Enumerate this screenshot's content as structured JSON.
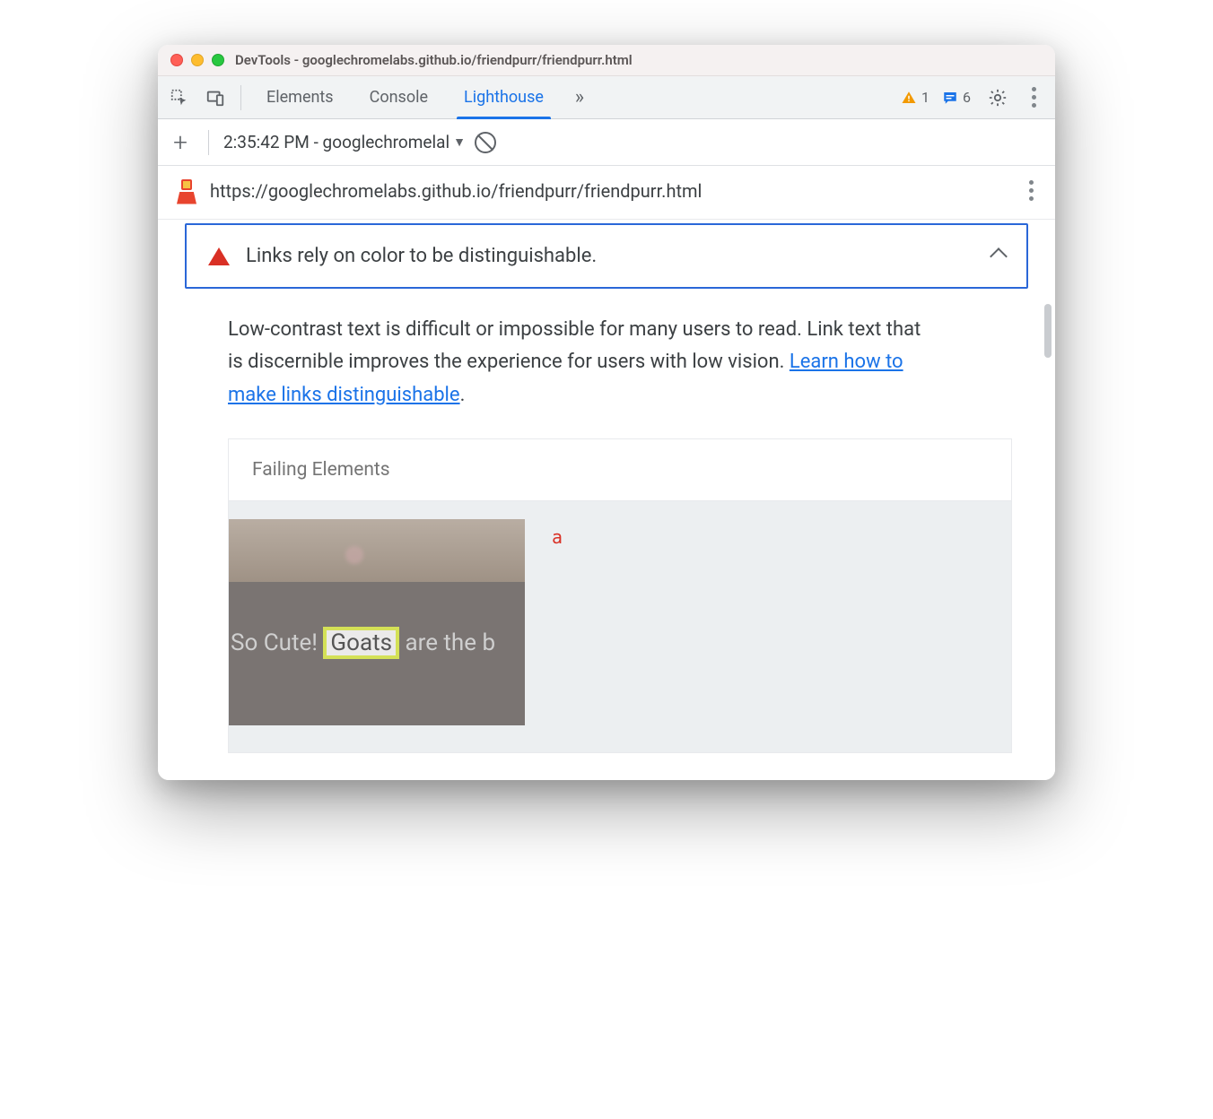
{
  "window": {
    "title": "DevTools - googlechromelabs.github.io/friendpurr/friendpurr.html"
  },
  "tabs": {
    "elements": "Elements",
    "console": "Console",
    "lighthouse": "Lighthouse"
  },
  "counters": {
    "warnings": "1",
    "messages": "6"
  },
  "lighthouse_toolbar": {
    "report_label": "2:35:42 PM - googlechromelal"
  },
  "report": {
    "url": "https://googlechromelabs.github.io/friendpurr/friendpurr.html"
  },
  "audit": {
    "title": "Links rely on color to be distinguishable.",
    "description_pre": "Low-contrast text is difficult or impossible for many users to read. Link text that is discernible improves the experience for users with low vision. ",
    "learn_link": "Learn how to make links distinguishable",
    "description_post": "."
  },
  "failing": {
    "header": "Failing Elements",
    "element_tag": "a",
    "thumb_text_pre": "So Cute! ",
    "thumb_text_hl": "Goats",
    "thumb_text_post": " are the b"
  }
}
